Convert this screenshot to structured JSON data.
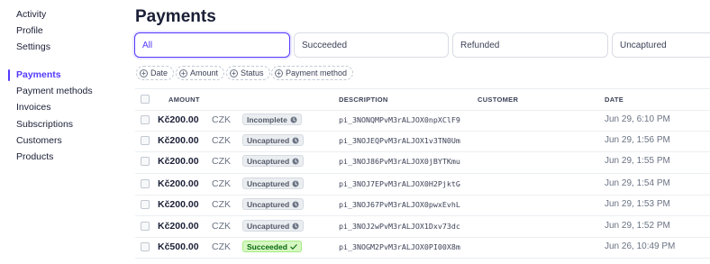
{
  "sidebar": {
    "items": [
      {
        "label": "Activity"
      },
      {
        "label": "Profile"
      },
      {
        "label": "Settings"
      },
      {
        "label": "Payments",
        "active": true
      },
      {
        "label": "Payment methods"
      },
      {
        "label": "Invoices"
      },
      {
        "label": "Subscriptions"
      },
      {
        "label": "Customers"
      },
      {
        "label": "Products"
      }
    ]
  },
  "page": {
    "title": "Payments"
  },
  "tabs": [
    {
      "label": "All",
      "active": true
    },
    {
      "label": "Succeeded"
    },
    {
      "label": "Refunded"
    },
    {
      "label": "Uncaptured"
    }
  ],
  "filters": [
    {
      "label": "Date"
    },
    {
      "label": "Amount"
    },
    {
      "label": "Status"
    },
    {
      "label": "Payment method"
    }
  ],
  "table": {
    "headers": {
      "amount": "AMOUNT",
      "description": "DESCRIPTION",
      "customer": "CUSTOMER",
      "date": "DATE"
    },
    "rows": [
      {
        "amount": "Kč200.00",
        "currency": "CZK",
        "status": "Incomplete",
        "description": "pi_3NONQMPvM3rALJOX0npXClF9",
        "date": "Jun 29, 6:10 PM"
      },
      {
        "amount": "Kč200.00",
        "currency": "CZK",
        "status": "Uncaptured",
        "description": "pi_3NOJEQPvM3rALJOX1v3TN0Um",
        "date": "Jun 29, 1:56 PM"
      },
      {
        "amount": "Kč200.00",
        "currency": "CZK",
        "status": "Uncaptured",
        "description": "pi_3NOJ86PvM3rALJOX0jBYTKmu",
        "date": "Jun 29, 1:55 PM"
      },
      {
        "amount": "Kč200.00",
        "currency": "CZK",
        "status": "Uncaptured",
        "description": "pi_3NOJ7EPvM3rALJOX0H2PjktG",
        "date": "Jun 29, 1:54 PM"
      },
      {
        "amount": "Kč200.00",
        "currency": "CZK",
        "status": "Uncaptured",
        "description": "pi_3NOJ67PvM3rALJOX0pwxEvhL",
        "date": "Jun 29, 1:53 PM"
      },
      {
        "amount": "Kč200.00",
        "currency": "CZK",
        "status": "Uncaptured",
        "description": "pi_3NOJ2wPvM3rALJOX1Dxv73dc",
        "date": "Jun 29, 1:52 PM"
      },
      {
        "amount": "Kč500.00",
        "currency": "CZK",
        "status": "Succeeded",
        "description": "pi_3NOGM2PvM3rALJOX0PI00X8m",
        "date": "Jun 26, 10:49 PM"
      }
    ]
  },
  "colors": {
    "accent": "#533afd",
    "succeeded_bg": "#d7f7c2",
    "succeeded_text": "#05690d",
    "neutral_badge_bg": "#ebeef1"
  },
  "icons": {
    "incomplete": "clock-icon",
    "uncaptured": "clock-icon",
    "succeeded": "check-icon",
    "filter": "plus-circle-icon"
  }
}
